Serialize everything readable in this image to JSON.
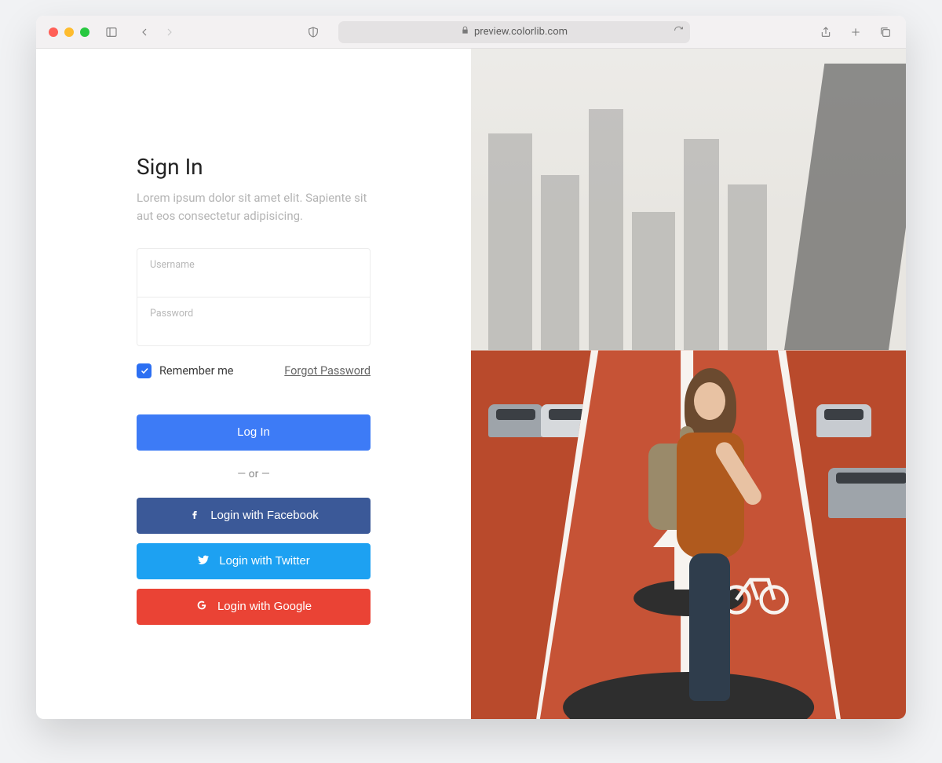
{
  "browser": {
    "url": "preview.colorlib.com"
  },
  "signin": {
    "title": "Sign In",
    "subtitle": "Lorem ipsum dolor sit amet elit. Sapiente sit aut eos consectetur adipisicing.",
    "username_label": "Username",
    "password_label": "Password",
    "remember_label": "Remember me",
    "forgot_label": "Forgot Password",
    "login_label": "Log In",
    "divider_label": "— or —",
    "facebook_label": "Login with Facebook",
    "twitter_label": "Login with Twitter",
    "google_label": "Login with Google",
    "remember_checked": true
  }
}
